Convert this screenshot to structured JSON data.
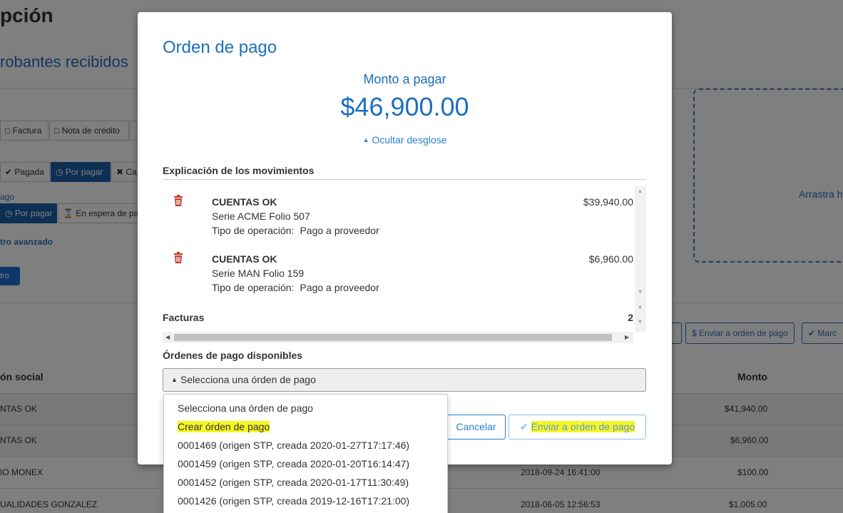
{
  "background": {
    "page_title": "pción",
    "section_title": "robantes recibidos",
    "type_buttons": [
      "Factura",
      "Nota de crédito"
    ],
    "status_buttons": [
      "Pagada",
      "Por pagar",
      "Ca"
    ],
    "payment_label": "ago",
    "payment_buttons": [
      "Por pagar",
      "En espera de pa"
    ],
    "advanced_filter": "tro avanzado",
    "filter_button": "tro",
    "drop_zone_text": "Arrastra h",
    "actions": [
      "Enviar a orden de pago",
      "Marc"
    ],
    "table_headers": {
      "name": "ón social",
      "amount": "Monto"
    },
    "rows": [
      {
        "name": "NTAS OK",
        "date": "",
        "amount": "$41,940.00"
      },
      {
        "name": "NTAS OK",
        "date": "",
        "amount": "$6,960.00"
      },
      {
        "name": "IO MONEX",
        "date": "2018-09-24 16:41:00",
        "amount": "$100.00"
      },
      {
        "name": "UALIDADES GONZALEZ",
        "date": "2018-06-05 12:56:53",
        "amount": "$1,005.00"
      }
    ]
  },
  "modal": {
    "title": "Orden de pago",
    "amount_label": "Monto a pagar",
    "amount": "$46,900.00",
    "toggle_label": "Ocultar desglose",
    "movements_heading": "Explicación de los movimientos",
    "movements": [
      {
        "name": "CUENTAS OK",
        "folio": "Serie ACME Folio 507",
        "op_label": "Tipo de operación:",
        "op_value": "Pago a proveedor",
        "amount": "$39,940.00"
      },
      {
        "name": "CUENTAS OK",
        "folio": "Serie MAN Folio 159",
        "op_label": "Tipo de operación:",
        "op_value": "Pago a proveedor",
        "amount": "$6,960.00"
      }
    ],
    "invoices_label": "Facturas",
    "invoices_count": "2",
    "orders_heading": "Órdenes de pago disponibles",
    "select_value": "Selecciona una órden de pago",
    "cancel_label": "Cancelar",
    "send_label": "Enviar a orden de pago"
  },
  "dropdown": {
    "options": [
      "Selecciona una órden de pago",
      "Crear órden de pago",
      "0001469 (origen STP, creada 2020-01-27T17:17:46)",
      "0001459 (origen STP, creada 2020-01-20T16:14:47)",
      "0001452 (origen STP, creada 2020-01-17T11:30:49)",
      "0001426 (origen STP, creada 2019-12-16T17:21:00)"
    ]
  },
  "colors": {
    "accent": "#1b6fc0",
    "highlight": "#f6f624",
    "trash": "#c0392b"
  }
}
